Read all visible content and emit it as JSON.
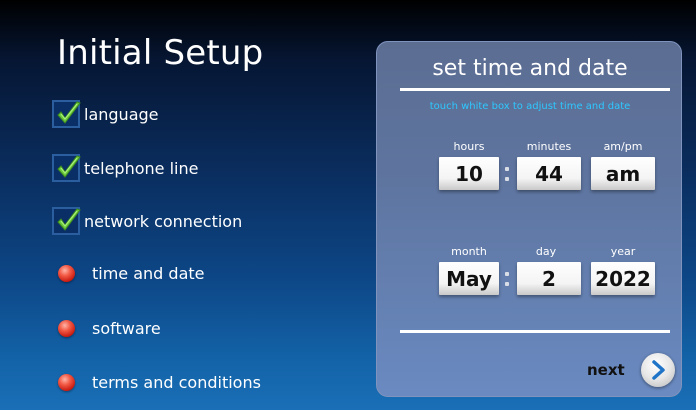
{
  "setup": {
    "title": "Initial Setup",
    "steps": [
      {
        "label": "language",
        "status": "complete"
      },
      {
        "label": "telephone line",
        "status": "complete"
      },
      {
        "label": "network connection",
        "status": "complete"
      },
      {
        "label": "time and date",
        "status": "pending"
      },
      {
        "label": "software",
        "status": "pending"
      },
      {
        "label": "terms and conditions",
        "status": "pending"
      }
    ]
  },
  "panel": {
    "title": "set time and date",
    "hint": "touch white box to adjust time and date",
    "time": {
      "hours_label": "hours",
      "hours_value": "10",
      "minutes_label": "minutes",
      "minutes_value": "44",
      "ampm_label": "am/pm",
      "ampm_value": "am"
    },
    "date": {
      "month_label": "month",
      "month_value": "May",
      "day_label": "day",
      "day_value": "2",
      "year_label": "year",
      "year_value": "2022"
    },
    "next_label": "next"
  },
  "icons": {
    "complete": "checkmark-icon",
    "pending": "red-dot-icon",
    "next": "chevron-right-icon"
  },
  "colors": {
    "check_green": "#6cc93d",
    "pending_red": "#e0301f",
    "hint_cyan": "#2ec8ff"
  }
}
